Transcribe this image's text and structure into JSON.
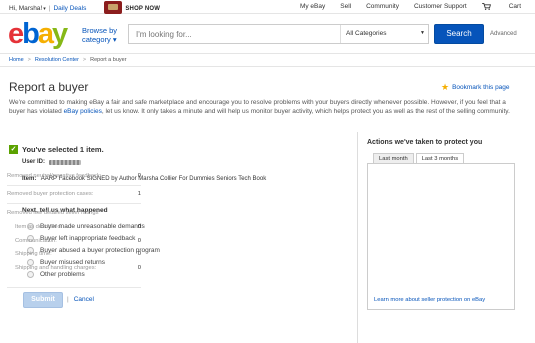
{
  "topbar": {
    "greeting": "Hi, Marsha!",
    "daily_deals": "Daily Deals",
    "promo": "SHOP NOW",
    "links": [
      "My eBay",
      "Sell",
      "Community",
      "Customer Support"
    ],
    "cart": "Cart"
  },
  "header": {
    "logo": {
      "e": "e",
      "b": "b",
      "a": "a",
      "y": "y"
    },
    "browse_line1": "Browse by",
    "browse_line2": "category ▾",
    "search_placeholder": "I'm looking for...",
    "category_select": "All Categories",
    "search_button": "Search",
    "advanced": "Advanced"
  },
  "breadcrumb": [
    "Home",
    "Resolution Center",
    "Report a buyer"
  ],
  "page": {
    "title": "Report a buyer",
    "bookmark": "Bookmark this page",
    "intro_1": "We're committed to making eBay a fair and safe marketplace and encourage you to resolve problems with your buyers directly whenever possible. However, if you feel that a buyer has violated ",
    "intro_link": "eBay policies",
    "intro_2": ", let us know. It only takes a minute and will help us monitor buyer activity, which helps protect you as well as the rest of the selling community."
  },
  "selection": {
    "title": "You've selected 1 item.",
    "user_id_label": "User ID:",
    "item_label": "Item:",
    "item_value": "AARP Facebook SIGNED by Author Marsha Collier For Dummies Seniors Tech Book"
  },
  "form": {
    "next_title": "Next, tell us what happened",
    "reasons": [
      "Buyer made unreasonable demands",
      "Buyer left inappropriate feedback",
      "Buyer abused a buyer protection program",
      "Buyer misused returns",
      "Other problems"
    ],
    "submit": "Submit",
    "cancel": "Cancel"
  },
  "protection": {
    "title": "Actions we've taken to protect you",
    "tabs": [
      "Last month",
      "Last 3 months"
    ],
    "active_tab": 1,
    "rows": [
      {
        "label": "Removed neutral/negative feedback:",
        "value": "0"
      },
      {
        "label": "Removed buyer protection cases:",
        "value": "1"
      }
    ],
    "ratings_header": "Removed low detailed seller ratings",
    "ratings": [
      {
        "label": "Item as described:",
        "value": "0"
      },
      {
        "label": "Communication:",
        "value": "0"
      },
      {
        "label": "Shipping time:",
        "value": "0"
      },
      {
        "label": "Shipping and handling charges:",
        "value": "0"
      }
    ],
    "learn_more": "Learn more about seller protection on eBay"
  },
  "colors": {
    "link": "#0654ba",
    "search_button": "#0654ba",
    "check": "#5ba200",
    "ebay_e": "#e53238",
    "ebay_b": "#0064d2",
    "ebay_a": "#f5af02",
    "ebay_y": "#86b817"
  }
}
